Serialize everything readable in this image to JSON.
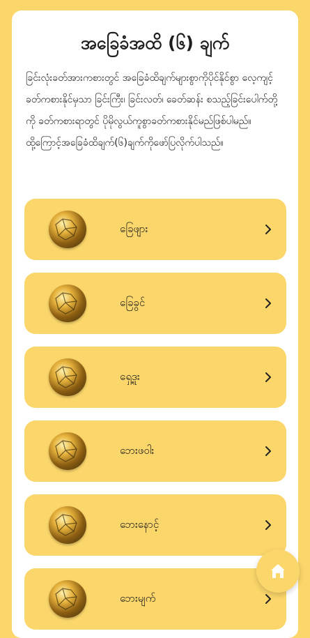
{
  "header": {
    "title": "အခြေခံအထိ (၆) ချက်"
  },
  "intro": {
    "text": "ခြင်းလုံးခတ်အားကစားတွင် အခြေခံထိချက်များစွာကိုပိုင်နိုင်စွာ လေ့ကျင့်ခတ်ကစားနိုင်မှသာ ခြင်းကြီး၊ ခြင်းလတ်၊ ခေတ်ဆန်း စသည့်ခြင်းပေါက်တို့ကို ခတ်ကစားရာတွင် ပိုမိုလွယ်ကူစွာခတ်ကစားနိုင်မည်ဖြစ်ပါမည်။ထို့ကြောင့်အခြေခံထိချက်(၆)ချက်ကိုဖော်ပြလိုက်ပါသည်။"
  },
  "items": [
    {
      "label": "ခြေဖျား"
    },
    {
      "label": "ခြေခွင်"
    },
    {
      "label": "ရှေ့ဒူး"
    },
    {
      "label": "ဘေးဖဝါး"
    },
    {
      "label": "ဘေးနောင့်"
    },
    {
      "label": "ဘေးမျက်"
    }
  ],
  "icons": {
    "item_icon": "ball-icon",
    "chevron": "chevron-right-icon",
    "home": "home-icon"
  },
  "colors": {
    "background": "#FBD66A",
    "card": "#FFFFFF",
    "item": "#FBD66A",
    "text": "#1E1E1E",
    "home_icon": "#FFFFFF"
  }
}
